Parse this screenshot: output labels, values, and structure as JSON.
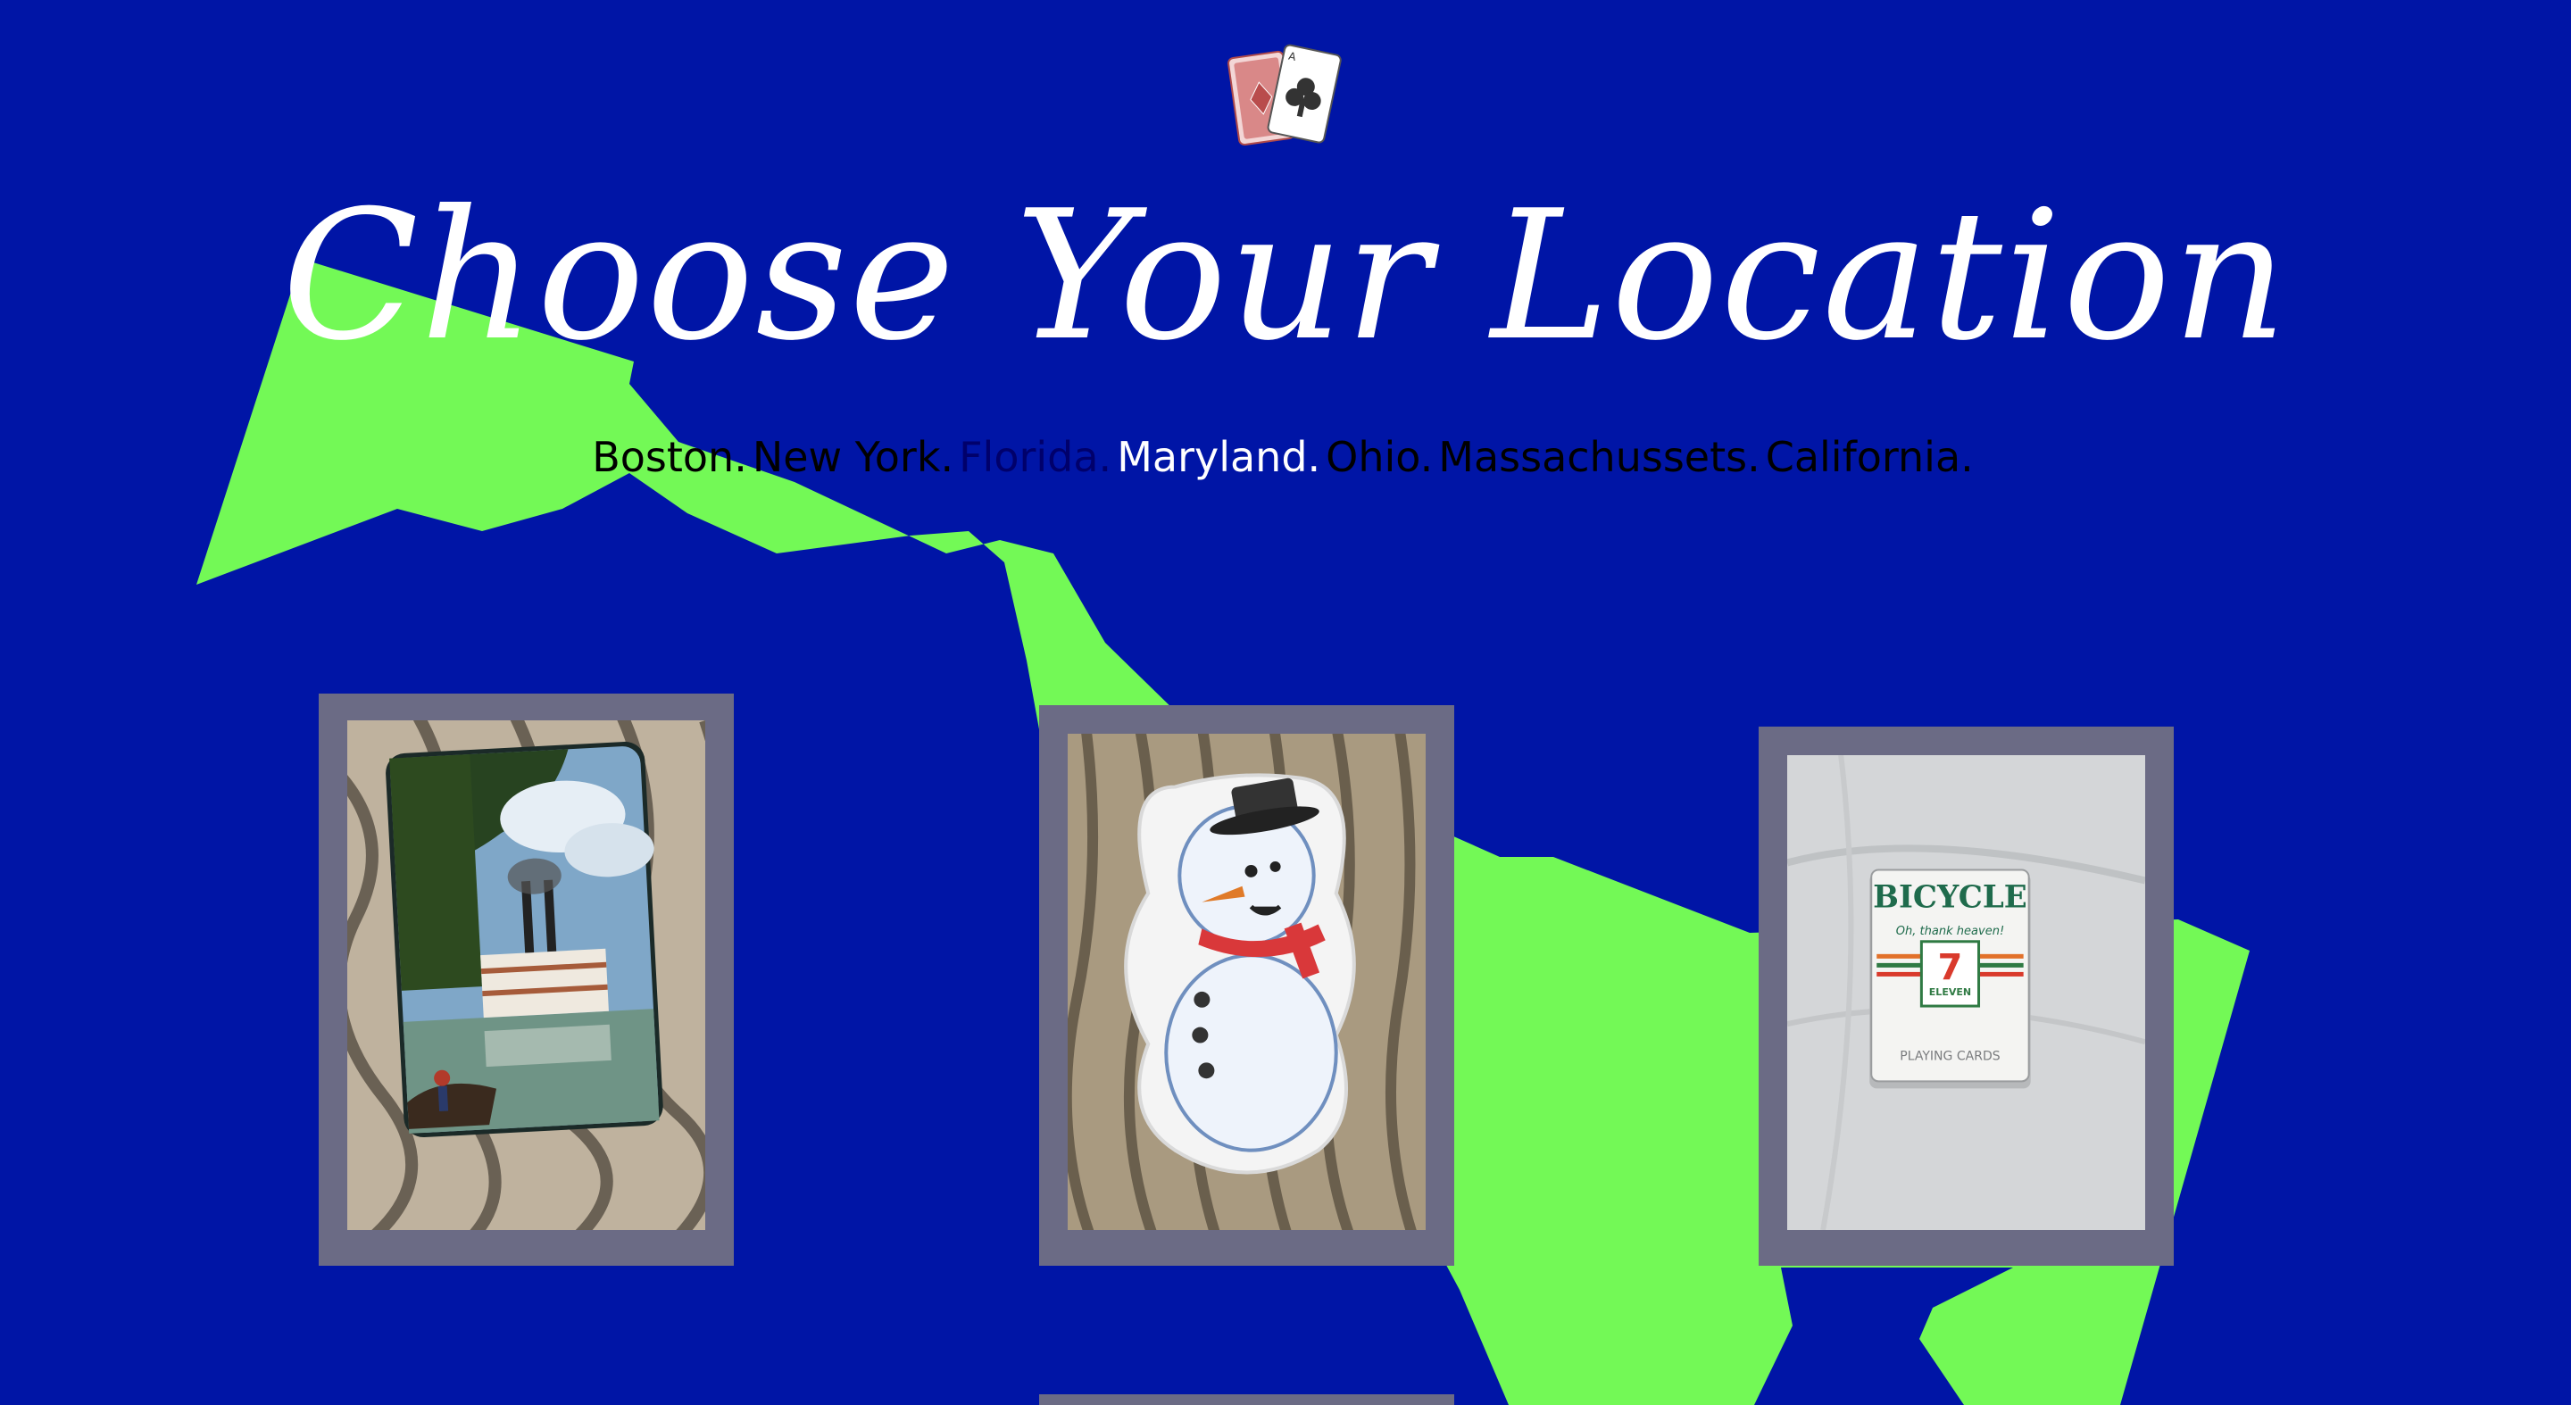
{
  "header": {
    "logo_icon": "playing-cards-icon",
    "title": "Choose Your Location"
  },
  "locations": [
    {
      "label": "Boston.",
      "color": "#000000"
    },
    {
      "label": "New York.",
      "color": "#000000"
    },
    {
      "label": "Florida.",
      "color": "#00006b"
    },
    {
      "label": "Maryland.",
      "color": "#ffffff"
    },
    {
      "label": "Ohio.",
      "color": "#000000"
    },
    {
      "label": "Massachussets.",
      "color": "#000000"
    },
    {
      "label": "California.",
      "color": "#000000"
    }
  ],
  "colors": {
    "background": "#0015a6",
    "map_shape": "#73f956",
    "card_frame": "#6b6b85",
    "title": "#ffffff"
  },
  "cards": [
    {
      "name": "riverboat-deck-card",
      "photo": "riverboat-playing-cards-photo"
    },
    {
      "name": "snowman-deck-card",
      "photo": "snowman-playing-cards-photo"
    },
    {
      "name": "bicycle-deck-card",
      "photo": "bicycle-7-eleven-playing-cards-photo",
      "brand_text": "BICYCLE",
      "slogan": "Oh, thank heaven!",
      "store_text": "ELEVEN",
      "sub_text": "PLAYING CARDS"
    }
  ]
}
